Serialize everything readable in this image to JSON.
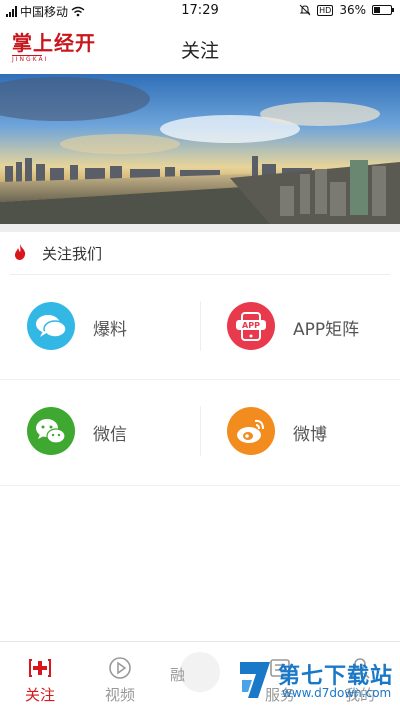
{
  "status_bar": {
    "carrier": "中国移动",
    "time": "17:29",
    "battery": "36%",
    "battery_level": 0.36,
    "icons": [
      "signal-icon",
      "wifi-icon",
      "mute-icon",
      "hd-icon",
      "battery-icon"
    ]
  },
  "header": {
    "logo_text": "掌上经开",
    "logo_sub": "JINGKAI",
    "title": "关注"
  },
  "section": {
    "title": "关注我们",
    "icon": "flame-icon"
  },
  "grid": [
    {
      "label": "爆料",
      "icon": "chat-bubble-icon",
      "color": "#33b8e6"
    },
    {
      "label": "APP矩阵",
      "icon": "app-icon",
      "color": "#e93a4d"
    },
    {
      "label": "微信",
      "icon": "wechat-icon",
      "color": "#3fa831"
    },
    {
      "label": "微博",
      "icon": "weibo-icon",
      "color": "#f28c1e"
    }
  ],
  "tabbar": [
    {
      "label": "关注",
      "icon": "follow-icon",
      "active": true
    },
    {
      "label": "视频",
      "icon": "play-icon",
      "active": false
    },
    {
      "label": "融",
      "icon": "center-icon",
      "active": false
    },
    {
      "label": "服务",
      "icon": "service-icon",
      "active": false
    },
    {
      "label": "我的",
      "icon": "user-icon",
      "active": false
    }
  ],
  "colors": {
    "brand": "#c8161d",
    "active_tab": "#d9161c",
    "inactive_tab": "#999999"
  },
  "watermark": {
    "title": "第七下载站",
    "url": "www.d7down.com"
  }
}
